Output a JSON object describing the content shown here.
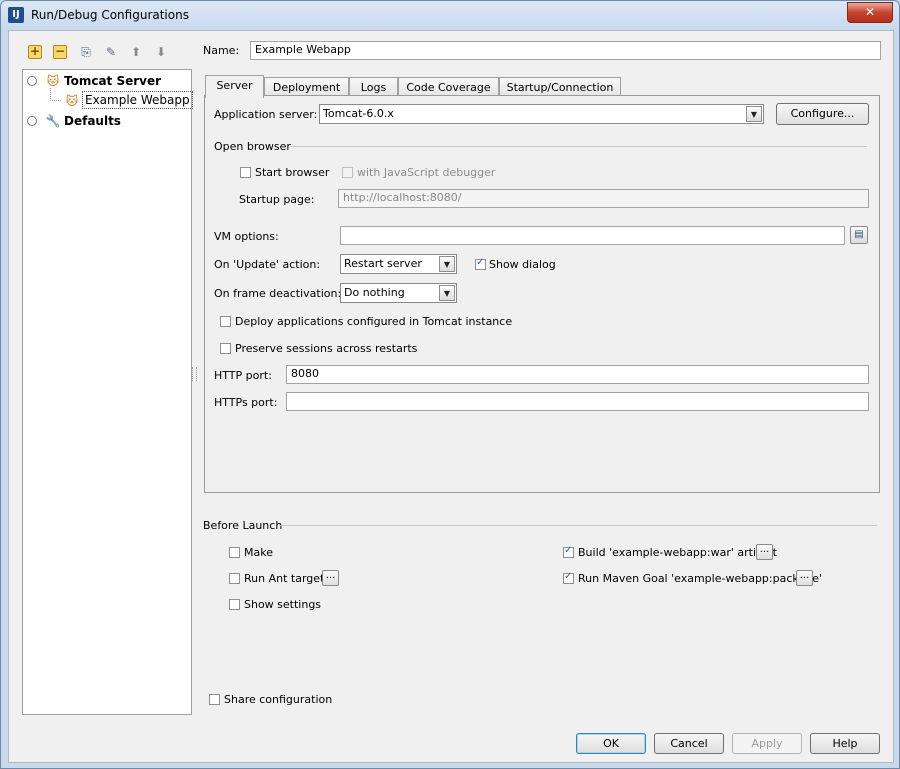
{
  "window": {
    "title": "Run/Debug Configurations",
    "close_glyph": "✕",
    "app_icon_text": "IJ"
  },
  "toolbar": {
    "icons": [
      "add-icon",
      "remove-icon",
      "copy-icon",
      "edit-defaults-icon",
      "move-up-icon",
      "move-down-icon"
    ]
  },
  "tree": {
    "tomcat_server": "Tomcat Server",
    "example_webapp": "Example Webapp",
    "defaults": "Defaults"
  },
  "name": {
    "label": "Name:",
    "value": "Example Webapp"
  },
  "tabs": [
    "Server",
    "Deployment",
    "Logs",
    "Code Coverage",
    "Startup/Connection"
  ],
  "server": {
    "app_server_label": "Application server:",
    "app_server_value": "Tomcat-6.0.x",
    "configure_button": "Configure...",
    "open_browser_header": "Open browser",
    "start_browser": "Start browser",
    "with_js_debugger": "with JavaScript debugger",
    "startup_page_label": "Startup page:",
    "startup_page_value": "http://localhost:8080/",
    "vm_options_label": "VM options:",
    "vm_options_value": "",
    "on_update_label": "On 'Update' action:",
    "on_update_value": "Restart server",
    "show_dialog": "Show dialog",
    "on_frame_label": "On frame deactivation:",
    "on_frame_value": "Do nothing",
    "deploy_apps": "Deploy applications configured in Tomcat instance",
    "preserve_sessions": "Preserve sessions across restarts",
    "http_port_label": "HTTP port:",
    "http_port_value": "8080",
    "https_port_label": "HTTPs port:",
    "https_port_value": ""
  },
  "before_launch": {
    "header": "Before Launch",
    "make": "Make",
    "run_ant": "Run Ant target",
    "show_settings": "Show settings",
    "build_artifact": "Build 'example-webapp:war' artifact",
    "run_maven": "Run Maven Goal 'example-webapp:package'",
    "ellipsis": "..."
  },
  "share_configuration": "Share configuration",
  "buttons": {
    "ok": "OK",
    "cancel": "Cancel",
    "apply": "Apply",
    "help": "Help"
  }
}
